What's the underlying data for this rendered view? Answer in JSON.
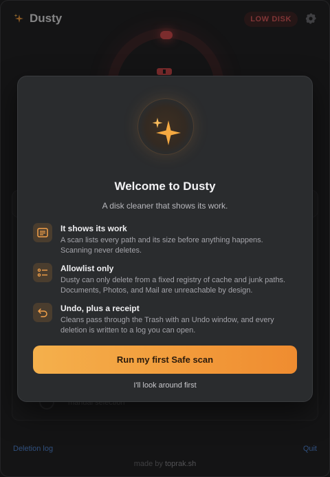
{
  "app": {
    "name": "Dusty",
    "disk_status": "LOW DISK",
    "background_text": "manual selection",
    "footer": {
      "deletion_log": "Deletion log",
      "quit": "Quit",
      "made_by_prefix": "made by",
      "made_by_name": "toprak.sh"
    }
  },
  "modal": {
    "title": "Welcome to Dusty",
    "subtitle": "A disk cleaner that shows its work.",
    "features": [
      {
        "icon": "receipt-icon",
        "title": "It shows its work",
        "description": "A scan lists every path and its size before anything happens. Scanning never deletes."
      },
      {
        "icon": "checklist-icon",
        "title": "Allowlist only",
        "description": "Dusty can only delete from a fixed registry of cache and junk paths. Documents, Photos, and Mail are unreachable by design."
      },
      {
        "icon": "undo-icon",
        "title": "Undo, plus a receipt",
        "description": "Cleans pass through the Trash with an Undo window, and every deletion is written to a log you can open."
      }
    ],
    "primary_button": "Run my first Safe scan",
    "secondary_link": "I'll look around first"
  },
  "colors": {
    "accent": "#f29a3a",
    "danger": "#d9474a",
    "link": "#4d86d9"
  }
}
